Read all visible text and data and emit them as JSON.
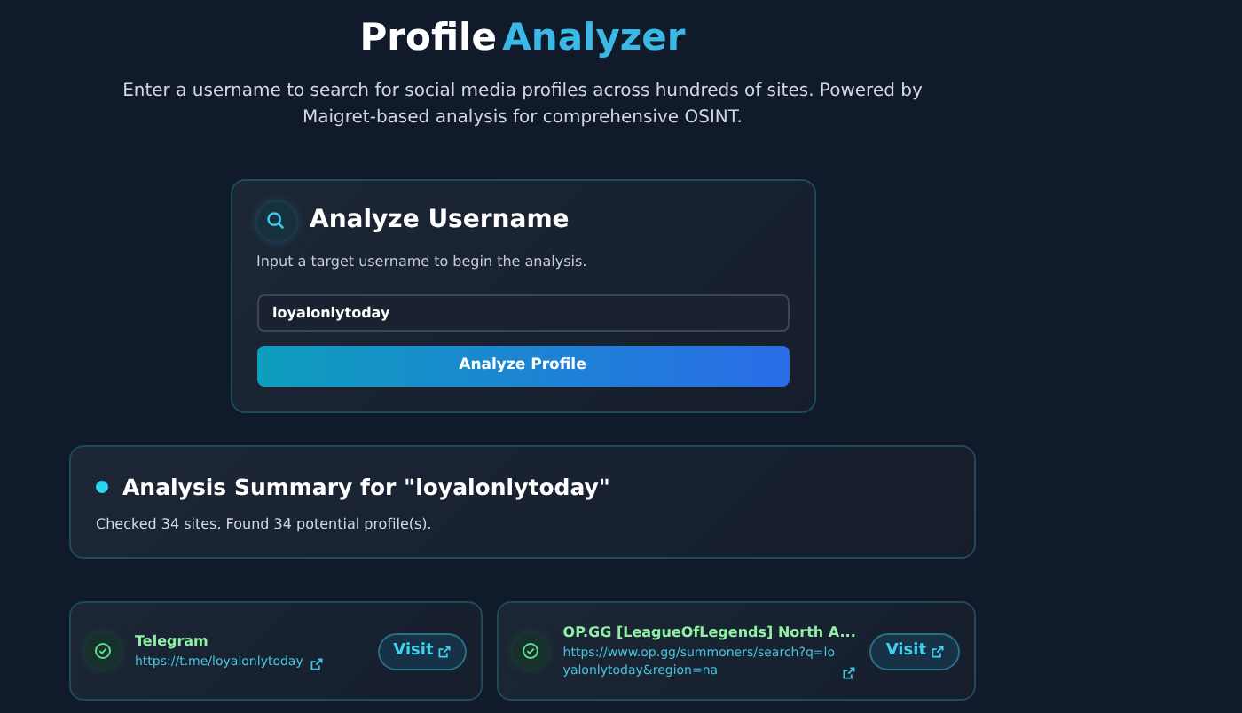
{
  "header": {
    "title": "Profile",
    "title_accent": "Analyzer",
    "subtitle": "Enter a username to search for social media profiles across hundreds of sites. Powered by Maigret-based analysis for comprehensive OSINT."
  },
  "search_card": {
    "title": "Analyze Username",
    "description": "Input a target username to begin the analysis.",
    "input": {
      "value": "loyalonlytoday"
    },
    "button": "Analyze Profile"
  },
  "summary": {
    "title": "Analysis Summary for \"loyalonlytoday\"",
    "text": "Checked 34 sites. Found 34 potential profile(s)."
  },
  "results": [
    {
      "site": "Telegram",
      "url": "https://t.me/loyalonlytoday",
      "found": true,
      "button": "Visit"
    },
    {
      "site": "OP.GG [LeagueOfLegends] North A...",
      "url": "https://www.op.gg/summoners/search?q=loyalonlytoday&region=na",
      "found": true,
      "button": "Visit"
    }
  ]
}
